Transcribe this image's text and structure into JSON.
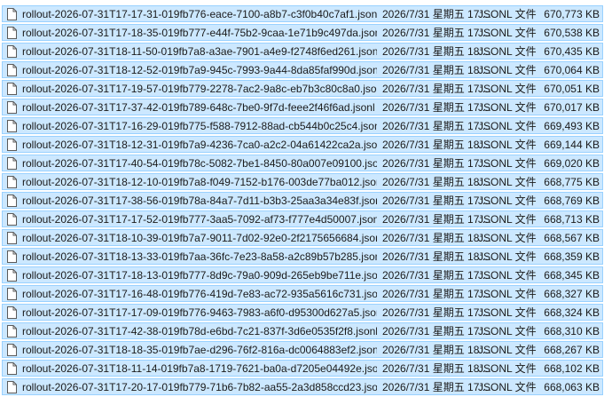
{
  "files": [
    {
      "name": "rollout-2026-07-31T17-17-31-019fb776-eace-7100-a8b7-c3f0b40c7af1.jsonl",
      "date": "2026/7/31 星期五 17:...",
      "type": "JSONL 文件",
      "size": "670,773 KB"
    },
    {
      "name": "rollout-2026-07-31T17-18-35-019fb777-e44f-75b2-9caa-1e71b9c497da.jsonl",
      "date": "2026/7/31 星期五 17:...",
      "type": "JSONL 文件",
      "size": "670,538 KB"
    },
    {
      "name": "rollout-2026-07-31T18-11-50-019fb7a8-a3ae-7901-a4e9-f2748f6ed261.jsonl",
      "date": "2026/7/31 星期五 18:...",
      "type": "JSONL 文件",
      "size": "670,435 KB"
    },
    {
      "name": "rollout-2026-07-31T18-12-52-019fb7a9-945c-7993-9a44-8da85faf990d.jsonl",
      "date": "2026/7/31 星期五 18:...",
      "type": "JSONL 文件",
      "size": "670,064 KB"
    },
    {
      "name": "rollout-2026-07-31T17-19-57-019fb779-2278-7ac2-9a8c-eb7b3c80c8a0.jsonl",
      "date": "2026/7/31 星期五 17:...",
      "type": "JSONL 文件",
      "size": "670,051 KB"
    },
    {
      "name": "rollout-2026-07-31T17-37-42-019fb789-648c-7be0-9f7d-feee2f46f6ad.jsonl",
      "date": "2026/7/31 星期五 17:...",
      "type": "JSONL 文件",
      "size": "670,017 KB"
    },
    {
      "name": "rollout-2026-07-31T17-16-29-019fb775-f588-7912-88ad-cb544b0c25c4.jsonl",
      "date": "2026/7/31 星期五 17:...",
      "type": "JSONL 文件",
      "size": "669,493 KB"
    },
    {
      "name": "rollout-2026-07-31T18-12-31-019fb7a9-4236-7ca0-a2c2-04a61422ca2a.jsonl",
      "date": "2026/7/31 星期五 18:...",
      "type": "JSONL 文件",
      "size": "669,144 KB"
    },
    {
      "name": "rollout-2026-07-31T17-40-54-019fb78c-5082-7be1-8450-80a007e09100.jsonl",
      "date": "2026/7/31 星期五 17:...",
      "type": "JSONL 文件",
      "size": "669,020 KB"
    },
    {
      "name": "rollout-2026-07-31T18-12-10-019fb7a8-f049-7152-b176-003de77ba012.jsonl",
      "date": "2026/7/31 星期五 18:...",
      "type": "JSONL 文件",
      "size": "668,775 KB"
    },
    {
      "name": "rollout-2026-07-31T17-38-56-019fb78a-84a7-7d11-b3b3-25aa3a34e83f.jsonl",
      "date": "2026/7/31 星期五 17:...",
      "type": "JSONL 文件",
      "size": "668,769 KB"
    },
    {
      "name": "rollout-2026-07-31T17-17-52-019fb777-3aa5-7092-af73-f777e4d50007.jsonl",
      "date": "2026/7/31 星期五 17:...",
      "type": "JSONL 文件",
      "size": "668,713 KB"
    },
    {
      "name": "rollout-2026-07-31T18-10-39-019fb7a7-9011-7d02-92e0-2f2175656684.jsonl",
      "date": "2026/7/31 星期五 18:...",
      "type": "JSONL 文件",
      "size": "668,567 KB"
    },
    {
      "name": "rollout-2026-07-31T18-13-33-019fb7aa-36fc-7e23-8a58-a2c89b57b285.jsonl",
      "date": "2026/7/31 星期五 18:...",
      "type": "JSONL 文件",
      "size": "668,359 KB"
    },
    {
      "name": "rollout-2026-07-31T17-18-13-019fb777-8d9c-79a0-909d-265eb9be711e.jsonl",
      "date": "2026/7/31 星期五 17:...",
      "type": "JSONL 文件",
      "size": "668,345 KB"
    },
    {
      "name": "rollout-2026-07-31T17-16-48-019fb776-419d-7e83-ac72-935a5616c731.jsonl",
      "date": "2026/7/31 星期五 17:...",
      "type": "JSONL 文件",
      "size": "668,327 KB"
    },
    {
      "name": "rollout-2026-07-31T17-17-09-019fb776-9463-7983-a6f0-d95300d627a5.jsonl",
      "date": "2026/7/31 星期五 17:...",
      "type": "JSONL 文件",
      "size": "668,324 KB"
    },
    {
      "name": "rollout-2026-07-31T17-42-38-019fb78d-e6bd-7c21-837f-3d6e0535f2f8.jsonl",
      "date": "2026/7/31 星期五 17:...",
      "type": "JSONL 文件",
      "size": "668,310 KB"
    },
    {
      "name": "rollout-2026-07-31T18-18-35-019fb7ae-d296-76f2-816a-dc0064883ef2.jsonl",
      "date": "2026/7/31 星期五 18:...",
      "type": "JSONL 文件",
      "size": "668,267 KB"
    },
    {
      "name": "rollout-2026-07-31T18-11-14-019fb7a8-1719-7621-ba0a-d7205e04492e.jsonl",
      "date": "2026/7/31 星期五 18:...",
      "type": "JSONL 文件",
      "size": "668,102 KB"
    },
    {
      "name": "rollout-2026-07-31T17-20-17-019fb779-71b6-7b82-aa55-2a3d858ccd23.jsonl",
      "date": "2026/7/31 星期五 17:...",
      "type": "JSONL 文件",
      "size": "668,063 KB"
    }
  ],
  "colors": {
    "selection_bg": "#cce8ff",
    "selection_border": "#99d1ff"
  },
  "icons": {
    "file": "document-icon"
  }
}
